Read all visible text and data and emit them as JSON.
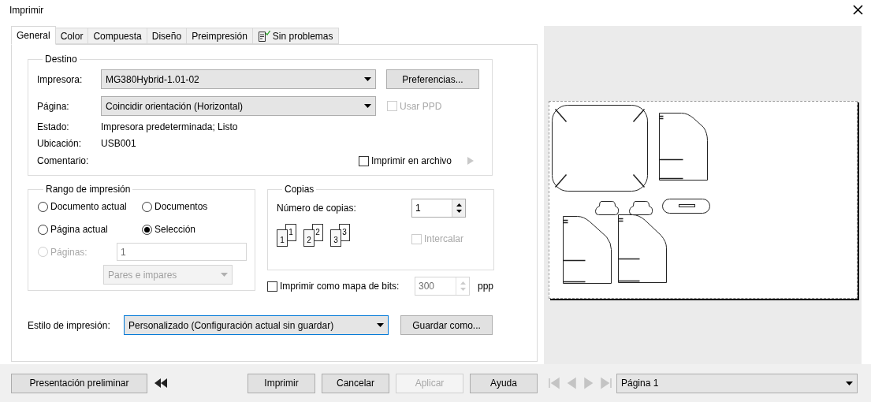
{
  "window": {
    "title": "Imprimir"
  },
  "tabs": [
    {
      "label": "General",
      "selected": true,
      "kind": "plain"
    },
    {
      "label": "Color",
      "selected": false,
      "kind": "plain"
    },
    {
      "label": "Compuesta",
      "selected": false,
      "kind": "plain"
    },
    {
      "label": "Diseño",
      "selected": false,
      "kind": "plain"
    },
    {
      "label": "Preimpresión",
      "selected": false,
      "kind": "plain"
    },
    {
      "label": "Sin problemas",
      "selected": false,
      "kind": "status"
    }
  ],
  "destination": {
    "title": "Destino",
    "printer": {
      "label": "Impresora:",
      "value": "MG380Hybrid-1.01-02"
    },
    "preferences_button": "Preferencias...",
    "page": {
      "label": "Página:",
      "value": "Coincidir orientación (Horizontal)"
    },
    "use_ppd": {
      "label": "Usar PPD",
      "checked": false,
      "disabled": true
    },
    "status": {
      "label": "Estado:",
      "value": "Impresora predeterminada; Listo"
    },
    "location": {
      "label": "Ubicación:",
      "value": "USB001"
    },
    "comment": {
      "label": "Comentario:"
    },
    "print_to_file": {
      "label": "Imprimir en archivo",
      "checked": false
    }
  },
  "range": {
    "title": "Rango de impresión",
    "options": [
      {
        "label": "Documento actual",
        "selected": false,
        "disabled": false
      },
      {
        "label": "Documentos",
        "selected": false,
        "disabled": false
      },
      {
        "label": "Página actual",
        "selected": false,
        "disabled": false
      },
      {
        "label": "Selección",
        "selected": true,
        "disabled": false
      },
      {
        "label": "Páginas:",
        "selected": false,
        "disabled": true
      }
    ],
    "pages_value": "1",
    "subset": "Pares e impares"
  },
  "copies": {
    "title": "Copias",
    "count_label": "Número de copias:",
    "count_value": "1",
    "sheets": [
      {
        "front": "1",
        "back": "1"
      },
      {
        "front": "2",
        "back": "2"
      },
      {
        "front": "3",
        "back": "3"
      }
    ],
    "collate": {
      "label": "Intercalar",
      "checked": false,
      "disabled": true
    }
  },
  "bitmap": {
    "label": "Imprimir como mapa de bits:",
    "checked": false,
    "value": "300",
    "unit": "ppp"
  },
  "print_style": {
    "label": "Estilo de impresión:",
    "value": "Personalizado (Configuración actual sin guardar)",
    "save_button": "Guardar como..."
  },
  "footer": {
    "preview_button": "Presentación preliminar",
    "buttons": [
      {
        "label": "Imprimir",
        "disabled": false
      },
      {
        "label": "Cancelar",
        "disabled": false
      },
      {
        "label": "Aplicar",
        "disabled": true
      },
      {
        "label": "Ayuda",
        "disabled": false
      }
    ],
    "page_select": "Página 1"
  }
}
